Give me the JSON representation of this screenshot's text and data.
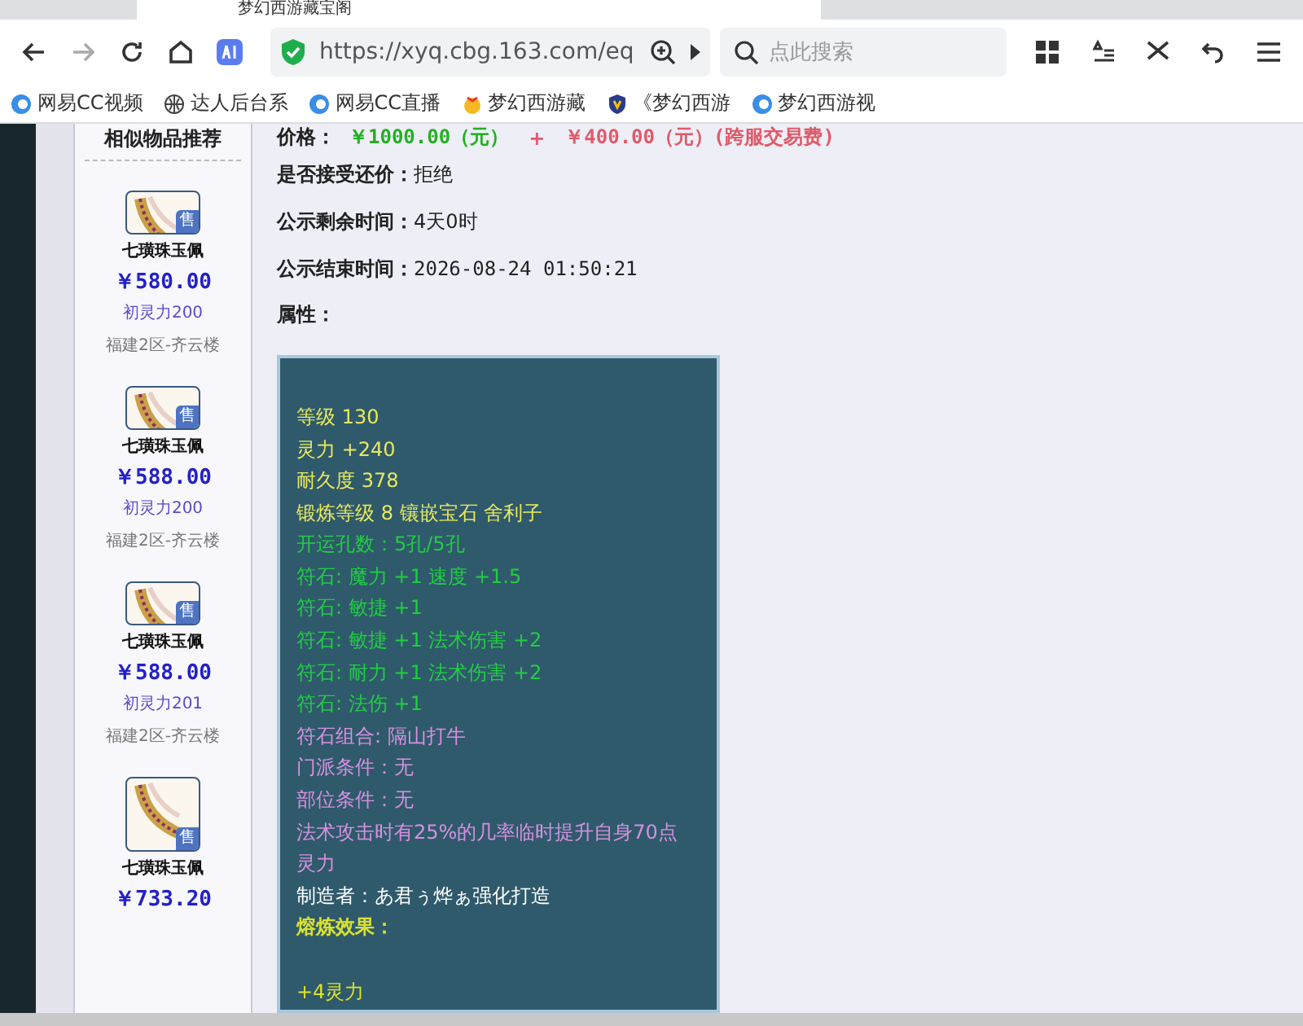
{
  "browser": {
    "tab_title": "梦幻西游藏宝阁",
    "url": "https://xyq.cbg.163.com/eq",
    "search": {
      "placeholder": "点此搜索"
    },
    "bookmarks": [
      {
        "label": "网易CC视频",
        "kind": "cc"
      },
      {
        "label": "达人后台系",
        "kind": "globe"
      },
      {
        "label": "网易CC直播",
        "kind": "cc"
      },
      {
        "label": "梦幻西游藏",
        "kind": "star"
      },
      {
        "label": "《梦幻西游",
        "kind": "shield"
      },
      {
        "label": "梦幻西游视",
        "kind": "cc"
      }
    ]
  },
  "sidebar": {
    "title": "相似物品推荐",
    "items": [
      {
        "name": "七璜珠玉佩",
        "price": "￥580.00",
        "attr": "初灵力200",
        "server": "福建2区-齐云楼",
        "badge": "售"
      },
      {
        "name": "七璜珠玉佩",
        "price": "￥588.00",
        "attr": "初灵力200",
        "server": "福建2区-齐云楼",
        "badge": "售"
      },
      {
        "name": "七璜珠玉佩",
        "price": "￥588.00",
        "attr": "初灵力201",
        "server": "福建2区-齐云楼",
        "badge": "售"
      },
      {
        "name": "七璜珠玉佩",
        "price": "￥733.20",
        "badge": "售"
      }
    ]
  },
  "detail": {
    "price": {
      "label": "价格：",
      "amount": "￥1000.00（元）",
      "plus": "+",
      "fee": "￥400.00（元）(跨服交易费)"
    },
    "fields": [
      {
        "label": "是否接受还价：",
        "value": "拒绝"
      },
      {
        "label": "公示剩余时间：",
        "value": "4天0时"
      },
      {
        "label": "公示结束时间：",
        "value": "2026-08-24 01:50:21"
      },
      {
        "label": "属性："
      }
    ],
    "attributes": [
      {
        "text": "等级 130",
        "kind": "base"
      },
      {
        "text": "灵力 +240",
        "kind": "base"
      },
      {
        "text": "耐久度 378",
        "kind": "base"
      },
      {
        "text": "锻炼等级 8 镶嵌宝石 舍利子",
        "kind": "base"
      },
      {
        "text": "开运孔数：5孔/5孔",
        "kind": "rune"
      },
      {
        "text": "符石: 魔力 +1 速度 +1.5",
        "kind": "rune"
      },
      {
        "text": "符石: 敏捷 +1",
        "kind": "rune"
      },
      {
        "text": "符石: 敏捷 +1 法术伤害 +2",
        "kind": "rune"
      },
      {
        "text": "符石: 耐力 +1 法术伤害 +2",
        "kind": "rune"
      },
      {
        "text": "符石: 法伤 +1",
        "kind": "rune"
      },
      {
        "text": "符石组合: 隔山打牛",
        "kind": "special"
      },
      {
        "text": "门派条件：无",
        "kind": "special"
      },
      {
        "text": "部位条件：无",
        "kind": "special"
      },
      {
        "text": "法术攻击时有25%的几率临时提升自身70点灵力",
        "kind": "special"
      },
      {
        "text": "制造者：あ君ぅ烨ぁ强化打造",
        "kind": "maker"
      },
      {
        "text": "熔炼效果：",
        "kind": "heading"
      },
      {
        "text": "+4灵力",
        "kind": "effect"
      }
    ]
  }
}
